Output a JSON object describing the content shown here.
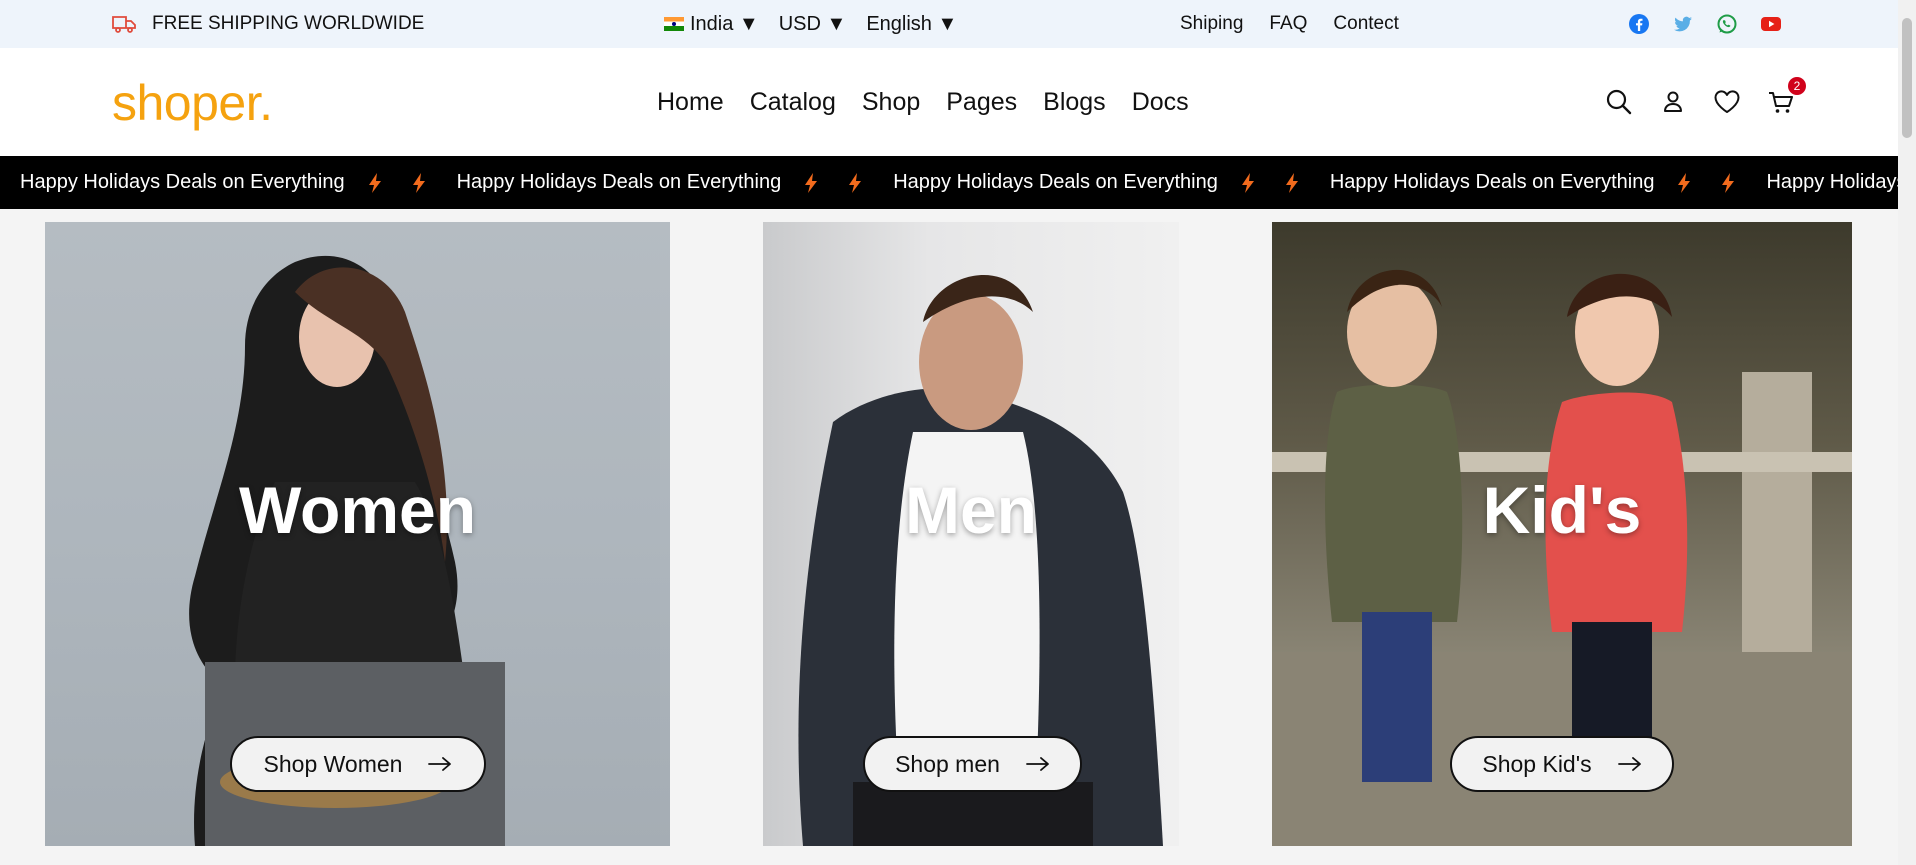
{
  "topbar": {
    "shipping_text": "FREE SHIPPING WORLDWIDE",
    "country": "India ▼",
    "currency": "USD ▼",
    "language": "English ▼",
    "links": [
      "Shiping",
      "FAQ",
      "Contect"
    ],
    "social": [
      "facebook-icon",
      "twitter-icon",
      "whatsapp-icon",
      "youtube-icon"
    ]
  },
  "header": {
    "logo": "shoper.",
    "nav": [
      "Home",
      "Catalog",
      "Shop",
      "Pages",
      "Blogs",
      "Docs"
    ],
    "cart_count": "2"
  },
  "marquee": {
    "text": "Happy Holidays Deals on Everything",
    "repeats": 5
  },
  "categories": [
    {
      "title": "Women",
      "button": "Shop Women"
    },
    {
      "title": "Men",
      "button": "Shop men"
    },
    {
      "title": "Kid's",
      "button": "Shop Kid's"
    }
  ],
  "colors": {
    "brand": "#f5a20f",
    "topbar_bg": "#eef4fb",
    "marquee_bg": "#000000",
    "bolt": "#f26b1d",
    "badge": "#d0021b"
  }
}
